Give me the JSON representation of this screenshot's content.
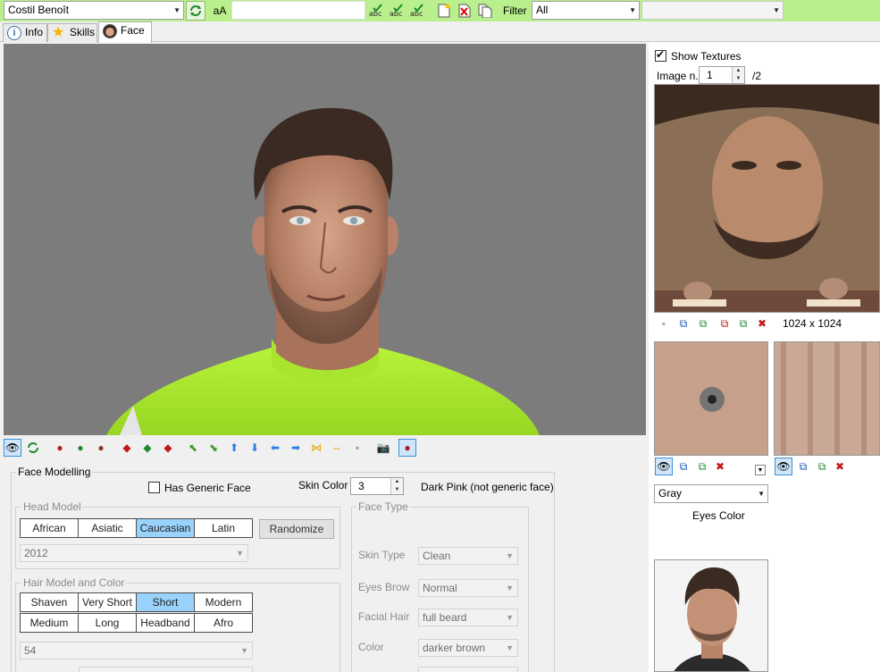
{
  "toolbar": {
    "player_select": "Costil Benoît",
    "case_button": "aA",
    "search_value": "",
    "filter_label": "Filter",
    "filter_value": "All",
    "extra_combo_value": ""
  },
  "tabs": [
    {
      "label": "Info"
    },
    {
      "label": "Skills"
    },
    {
      "label": "Face"
    }
  ],
  "face_modelling": {
    "title": "Face Modelling",
    "has_generic_face": "Has Generic Face",
    "has_generic_face_checked": false,
    "skin_color_label": "Skin Color",
    "skin_color_value": "3",
    "skin_color_desc": "Dark Pink (not generic face)",
    "head_model": {
      "title": "Head Model",
      "options": [
        "African",
        "Asiatic",
        "Caucasian",
        "Latin"
      ],
      "selected": "Caucasian",
      "randomize_label": "Randomize",
      "model_value": "2012"
    },
    "hair": {
      "title": "Hair Model and Color",
      "row1": [
        "Shaven",
        "Very Short",
        "Short",
        "Modern"
      ],
      "row2": [
        "Medium",
        "Long",
        "Headband",
        "Afro"
      ],
      "selected": "Short",
      "model_value": "54"
    },
    "face_type": {
      "title": "Face Type",
      "skin_type_label": "Skin Type",
      "skin_type_value": "Clean",
      "eyes_brow_label": "Eyes Brow",
      "eyes_brow_value": "Normal",
      "facial_hair_label": "Facial Hair",
      "facial_hair_value": "full beard",
      "color_label": "Color",
      "color_value": "darker brown"
    }
  },
  "textures": {
    "show_textures_label": "Show Textures",
    "show_textures_checked": true,
    "image_n_label": "Image n.",
    "image_n_value": "1",
    "image_total": "/2",
    "resolution": "1024 x 1024",
    "eyes_color_value": "Gray",
    "eyes_color_label": "Eyes Color"
  },
  "colors": {
    "toolbar_bg": "#b9ef8d",
    "viewport_bg": "#7c7c7c",
    "selected_seg": "#99d2fb",
    "jersey": "#b7f23a"
  }
}
